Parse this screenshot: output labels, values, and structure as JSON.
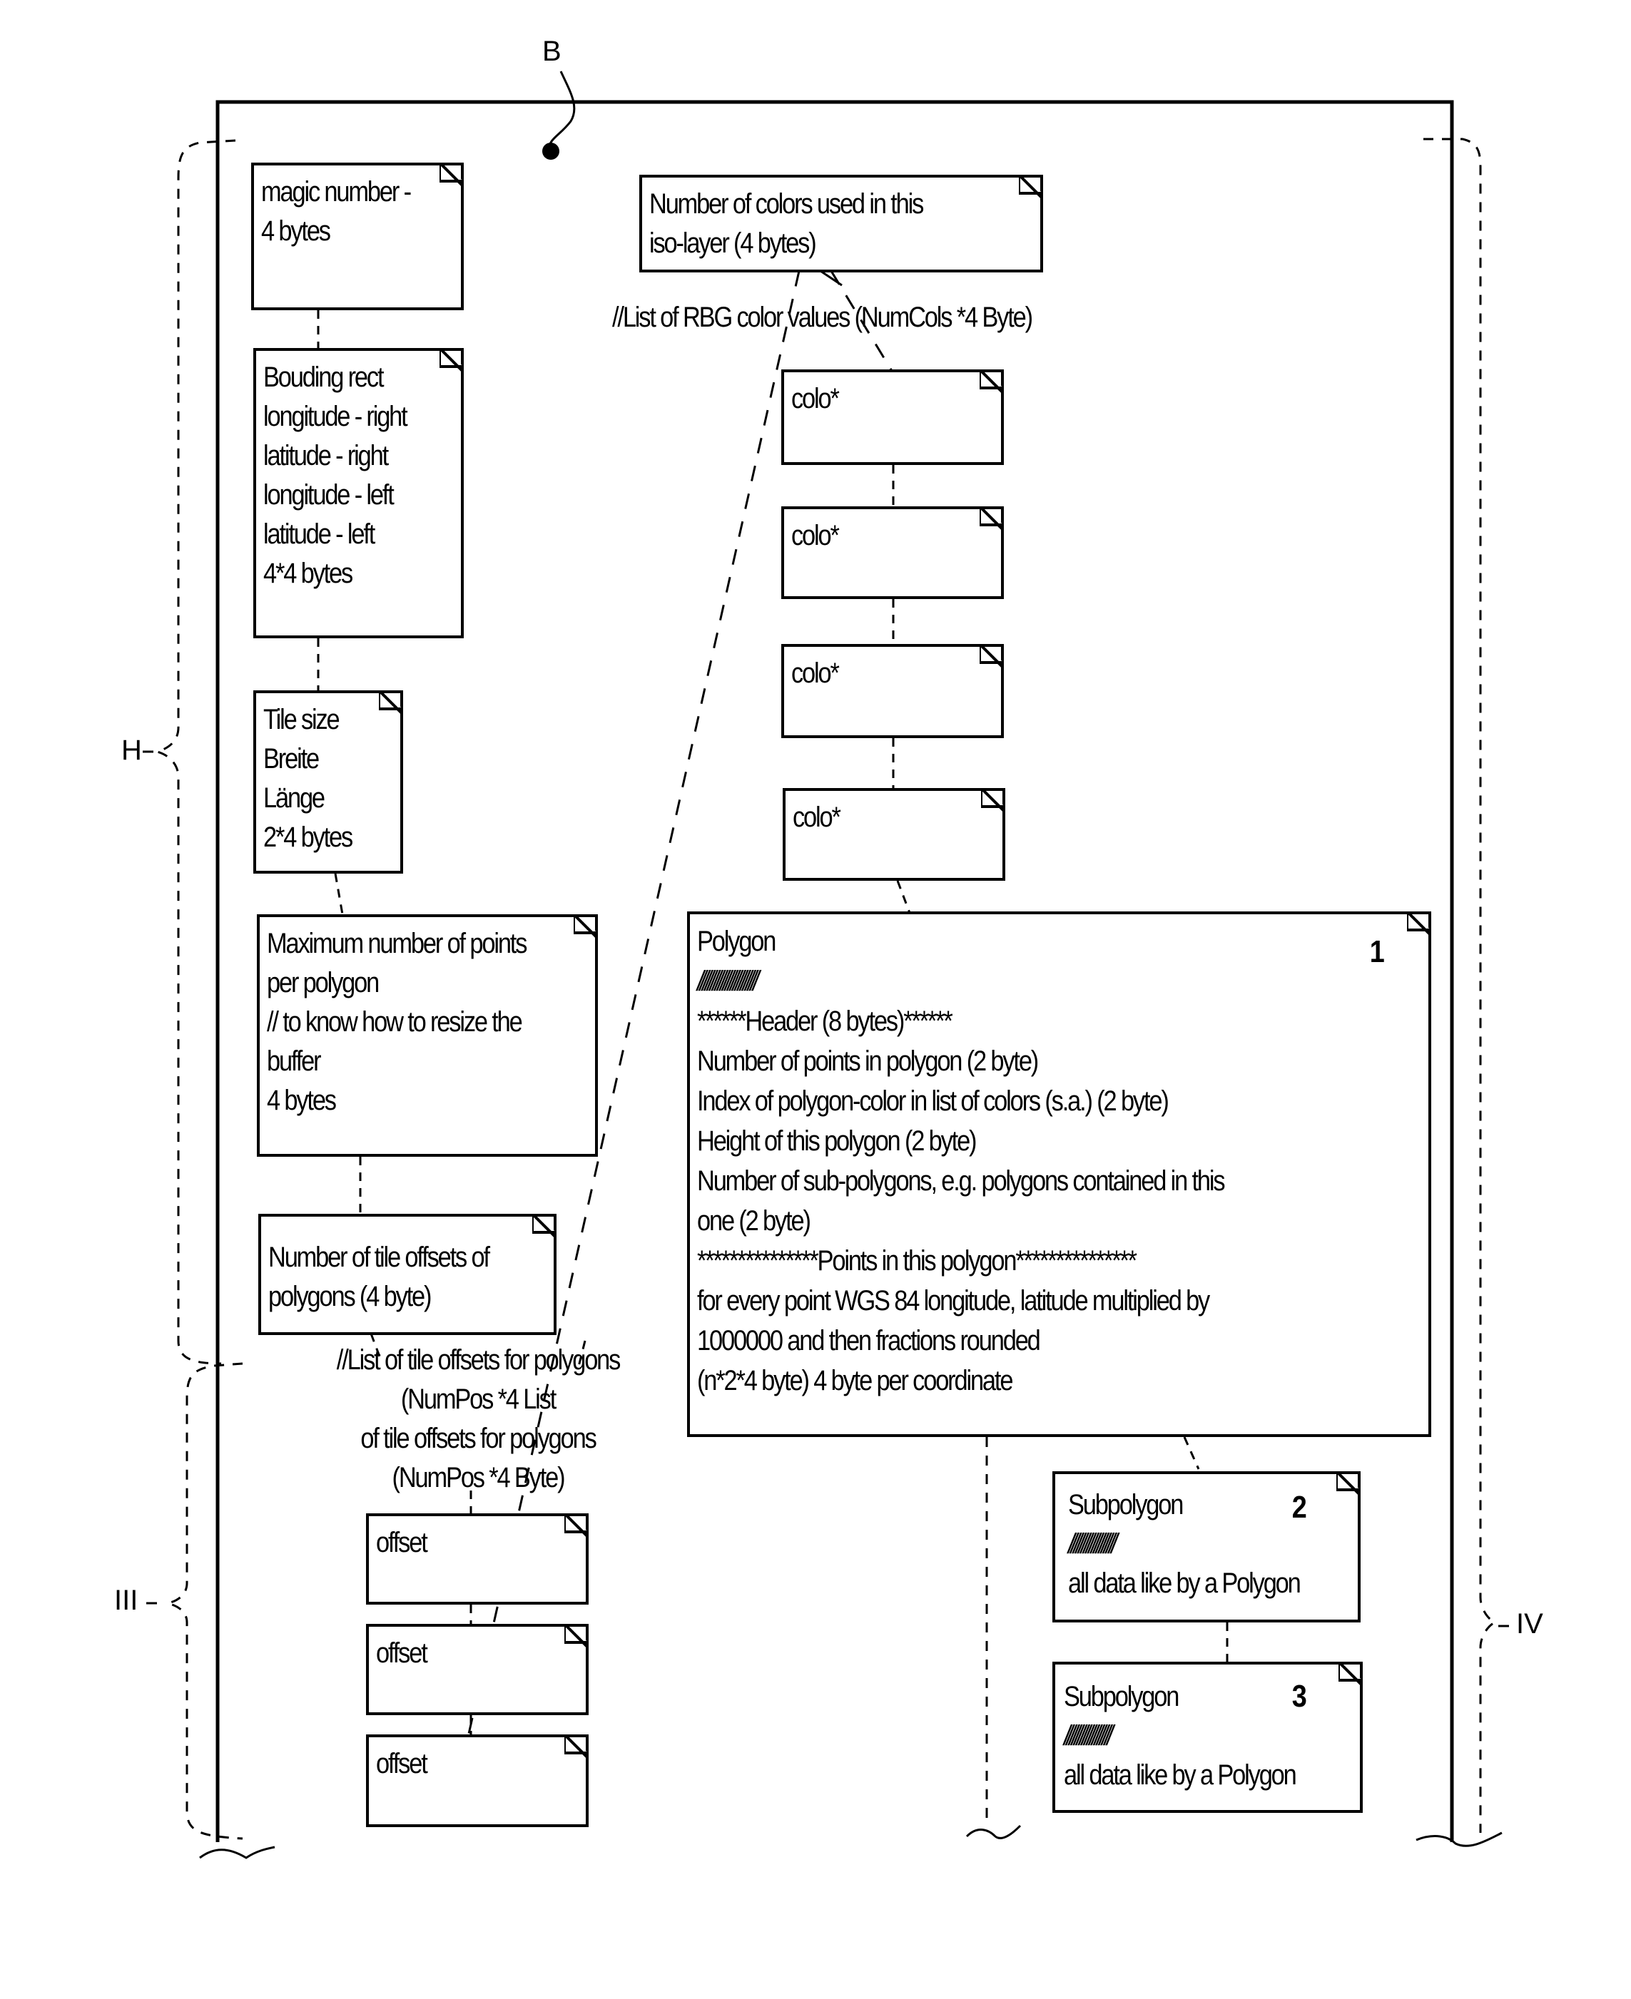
{
  "figure": {
    "reference_label": "B",
    "brace_labels": {
      "header": "H",
      "offsets": "III",
      "colors_polygons": "IV"
    }
  },
  "header_column": {
    "magic_number": [
      "magic number -",
      "4 bytes"
    ],
    "bounding_rect": [
      "Bouding rect",
      "longitude - right",
      "latitude - right",
      "longitude - left",
      "latitude - left",
      "4*4 bytes"
    ],
    "tile_size": [
      "Tile size",
      "Breite",
      "Länge",
      "2*4 bytes"
    ],
    "max_points": [
      "Maximum number of points",
      "per polygon",
      "// to know how to resize the",
      "buffer",
      "4 bytes"
    ],
    "num_tile_offsets": [
      "Number of tile offsets of",
      "polygons (4 byte)"
    ]
  },
  "offset_list": {
    "label": [
      "//List of tile offsets for polygons",
      "(NumPos *4 List",
      "of tile offsets for polygons",
      "(NumPos *4 Byte)"
    ],
    "items": [
      "offset",
      "offset",
      "offset"
    ]
  },
  "color_column": {
    "num_colors": [
      "Number of colors used in this",
      "iso-layer (4 bytes)"
    ],
    "list_label": "//List of RBG color values (NumCols *4 Byte)",
    "items": [
      "colo*",
      "colo*",
      "colo*",
      "colo*"
    ]
  },
  "polygon": {
    "number": "1",
    "lines": [
      "Polygon",
      "///////////////////////",
      "******Header (8 bytes)******",
      "Number of points in polygon (2 byte)",
      "Index of polygon-color in list of colors (s.a.) (2 byte)",
      "Height of this polygon (2 byte)",
      "Number of sub-polygons, e.g. polygons contained in this",
      "one (2 byte)",
      "***************Points in this polygon***************",
      "for every point WGS 84 longitude, latitude multiplied by",
      "1000000 and then fractions rounded",
      "(n*2*4 byte) 4 byte per coordinate"
    ]
  },
  "subpolygons": [
    {
      "number": "2",
      "title": "Subpolygon",
      "hatch": "//////////////////",
      "text": "all data like by a Polygon"
    },
    {
      "number": "3",
      "title": "Subpolygon",
      "hatch": "//////////////////",
      "text": "all data like by a Polygon"
    }
  ]
}
